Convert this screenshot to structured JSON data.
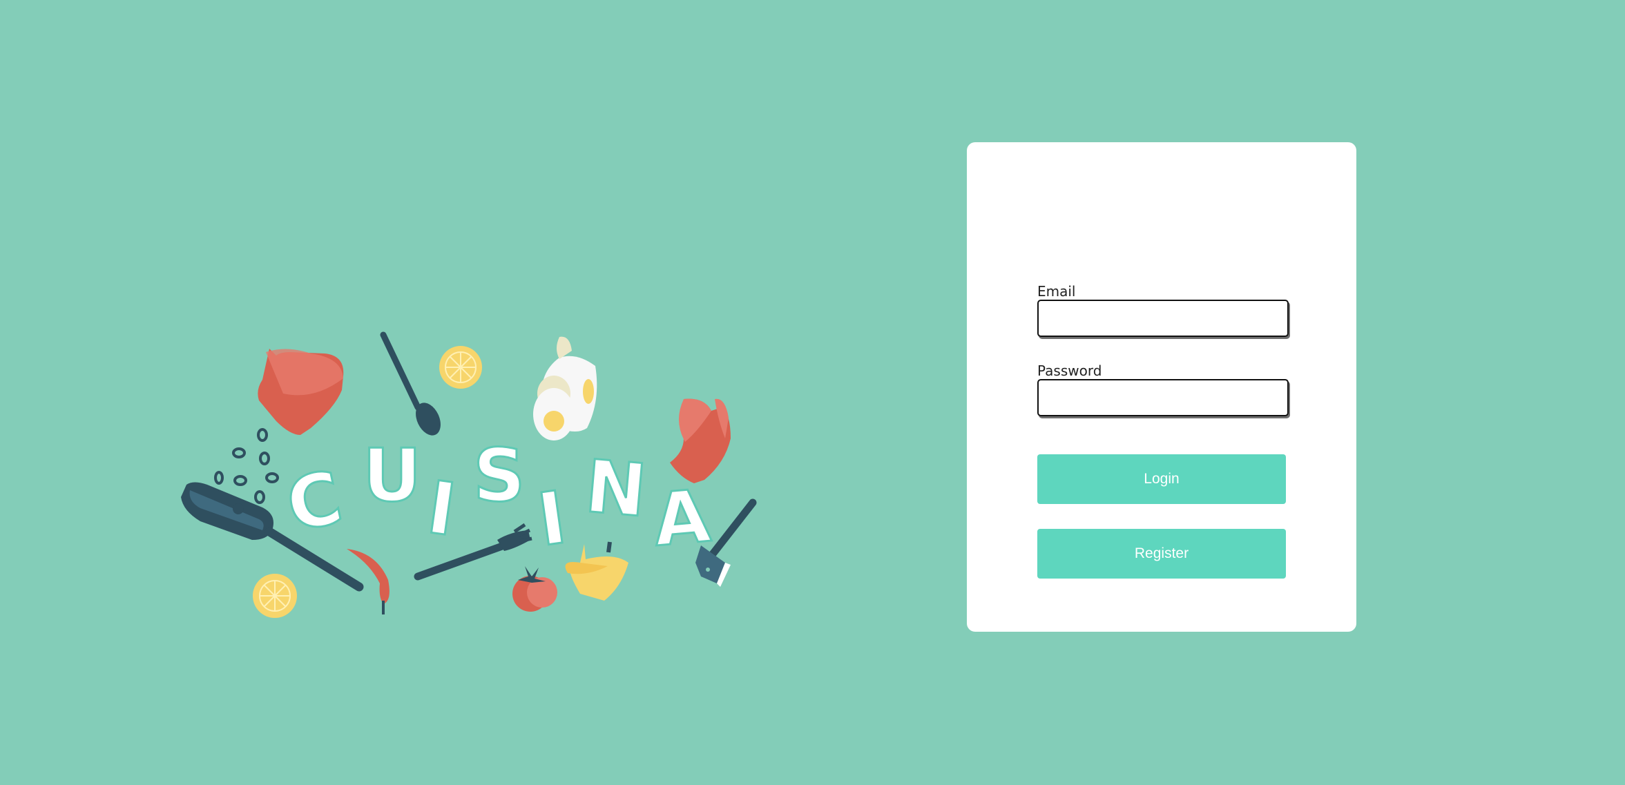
{
  "logo": {
    "word": "CUISINA",
    "letters": [
      "C",
      "U",
      "I",
      "S",
      "I",
      "N",
      "A"
    ]
  },
  "login_form": {
    "email_label": "Email",
    "email_value": "",
    "password_label": "Password",
    "password_value": "",
    "login_label": "Login",
    "register_label": "Register"
  },
  "colors": {
    "background": "#83cdb8",
    "card": "#ffffff",
    "button": "#5ed6be",
    "button_text": "#ffffff",
    "dark_utensil": "#2f4f5f",
    "mitt_red": "#d9604f",
    "yellow": "#f7d56b"
  },
  "icons": [
    "oven-mitt-icon",
    "spoon-icon",
    "lemon-slice-icon",
    "egg-icon",
    "frying-pan-icon",
    "beans-icon",
    "chili-pepper-icon",
    "fork-icon",
    "tomato-icon",
    "bell-pepper-icon",
    "cleaver-icon"
  ]
}
